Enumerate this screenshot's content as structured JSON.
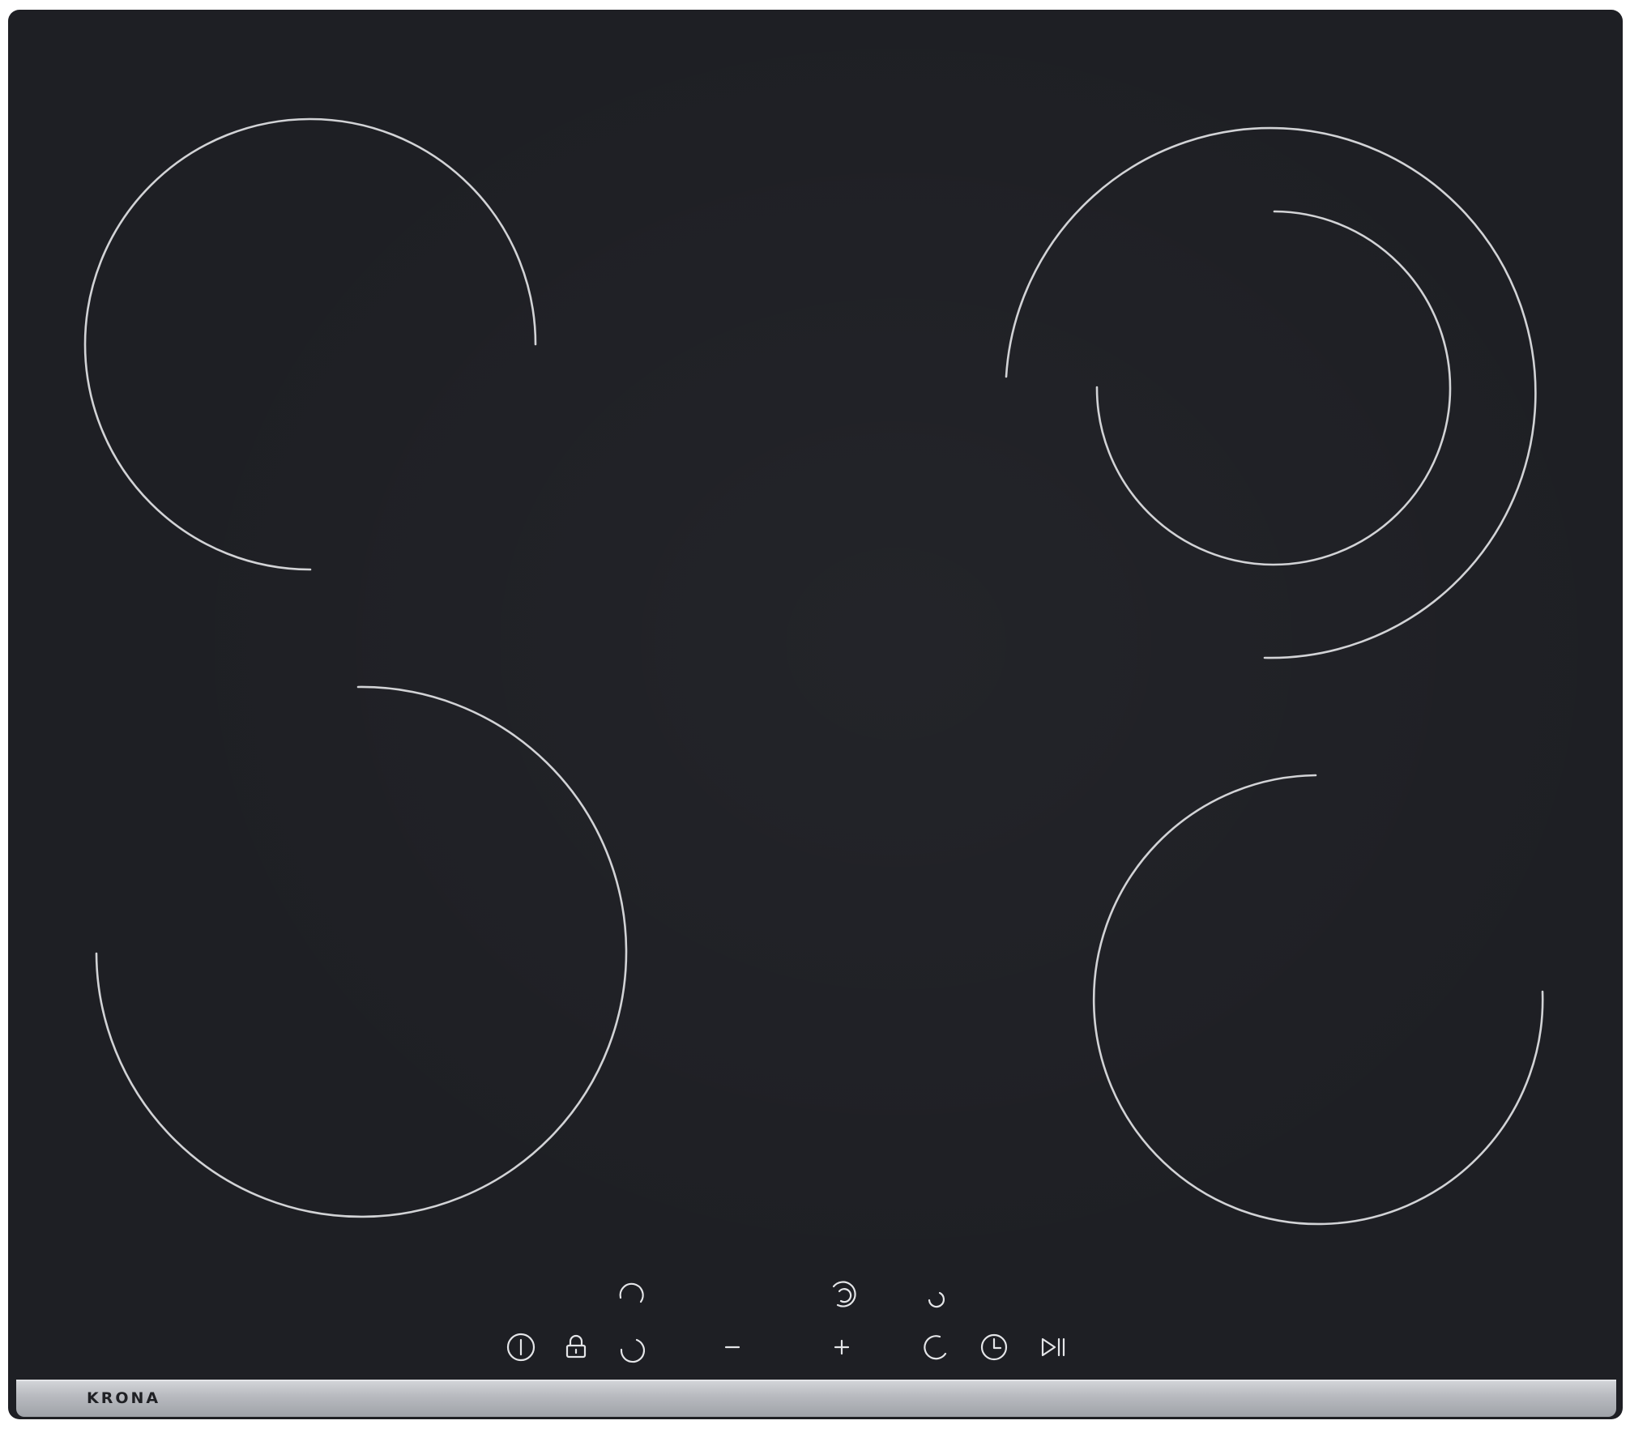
{
  "product": {
    "brand": "KRONA",
    "surface_color": "#1e1f24",
    "ring_color": "#d2d3d6",
    "trim_color": "#b9bbc0"
  },
  "cooking_zones": [
    {
      "id": "front-left",
      "type": "single"
    },
    {
      "id": "rear-left",
      "type": "single"
    },
    {
      "id": "rear-right",
      "type": "dual"
    },
    {
      "id": "front-right",
      "type": "single"
    }
  ],
  "touch_controls": [
    {
      "name": "power",
      "icon": "power-icon",
      "label": ""
    },
    {
      "name": "lock",
      "icon": "lock-icon",
      "label": ""
    },
    {
      "name": "zone-selector-left",
      "icon": "zone-selector-icon",
      "label": ""
    },
    {
      "name": "minus",
      "icon": "minus-icon",
      "label": "−"
    },
    {
      "name": "plus",
      "icon": "plus-icon",
      "label": "+"
    },
    {
      "name": "zone-selector-right",
      "icon": "zone-selector-icon",
      "label": ""
    },
    {
      "name": "timer",
      "icon": "clock-icon",
      "label": ""
    },
    {
      "name": "pause",
      "icon": "play-pause-icon",
      "label": ""
    }
  ],
  "zone_indicators": [
    "rear-left-indicator",
    "dual-zone-indicator",
    "rear-right-indicator"
  ]
}
